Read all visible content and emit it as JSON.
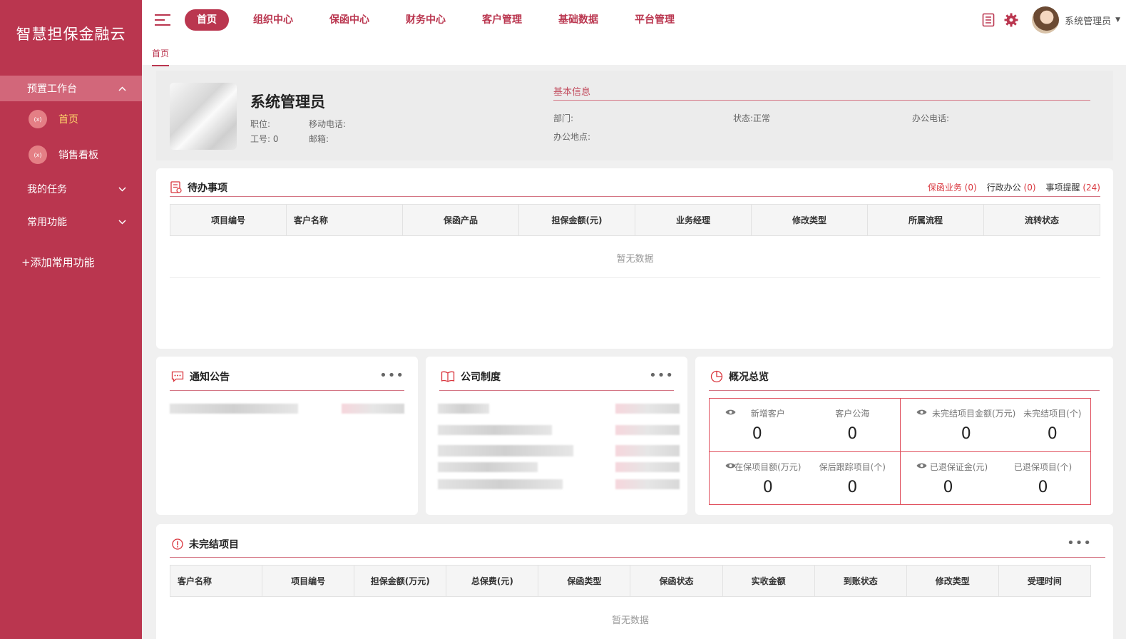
{
  "app": {
    "brand": "智慧担保金融云"
  },
  "sidebar": {
    "group_workbench": "预置工作台",
    "items": [
      {
        "label": "首页",
        "icon_text": "(x)"
      },
      {
        "label": "销售看板",
        "icon_text": "(x)"
      }
    ],
    "group_tasks": "我的任务",
    "group_common": "常用功能",
    "add_function": "+添加常用功能"
  },
  "topnav": {
    "items": [
      "首页",
      "组织中心",
      "保函中心",
      "财务中心",
      "客户管理",
      "基础数据",
      "平台管理"
    ],
    "active_index": 0,
    "username": "系统管理员"
  },
  "tabs": {
    "home": "首页"
  },
  "profile": {
    "name": "系统管理员",
    "position_label": "职位:",
    "mobile_label": "移动电话:",
    "job_no_label": "工号:",
    "job_no_value": "0",
    "email_label": "邮箱:",
    "basic_info_title": "基本信息",
    "dept_label": "部门:",
    "status_label": "状态:",
    "status_value": "正常",
    "office_phone_label": "办公电话:",
    "office_location_label": "办公地点:"
  },
  "todo": {
    "title": "待办事项",
    "links": [
      {
        "label": "保函业务",
        "count": "(0)"
      },
      {
        "label": "行政办公",
        "count": "(0)"
      },
      {
        "label": "事项提醒",
        "count": "(24)"
      }
    ],
    "columns": [
      "项目编号",
      "客户名称",
      "保函产品",
      "担保金额(元)",
      "业务经理",
      "修改类型",
      "所属流程",
      "流转状态"
    ],
    "empty_text": "暂无数据"
  },
  "notice": {
    "title": "通知公告",
    "more": "•••"
  },
  "policy": {
    "title": "公司制度",
    "more": "•••"
  },
  "overview": {
    "title": "概况总览",
    "cells": [
      {
        "a_label": "新增客户",
        "a_value": "0",
        "b_label": "客户公海",
        "b_value": "0"
      },
      {
        "a_label": "未完结项目金额(万元)",
        "a_value": "0",
        "b_label": "未完结项目(个)",
        "b_value": "0"
      },
      {
        "a_label": "在保项目额(万元)",
        "a_value": "0",
        "b_label": "保后跟踪项目(个)",
        "b_value": "0"
      },
      {
        "a_label": "已退保证金(元)",
        "a_value": "0",
        "b_label": "已退保项目(个)",
        "b_value": "0"
      }
    ]
  },
  "unfinished": {
    "title": "未完结项目",
    "more": "•••",
    "columns": [
      "客户名称",
      "项目编号",
      "担保金额(万元)",
      "总保费(元)",
      "保函类型",
      "保函状态",
      "实收金额",
      "到账状态",
      "修改类型",
      "受理时间"
    ],
    "empty_text": "暂无数据"
  },
  "colors": {
    "primary": "#ba364f",
    "sidebar_active": "#d2677a",
    "accent_red": "#d9363e"
  }
}
